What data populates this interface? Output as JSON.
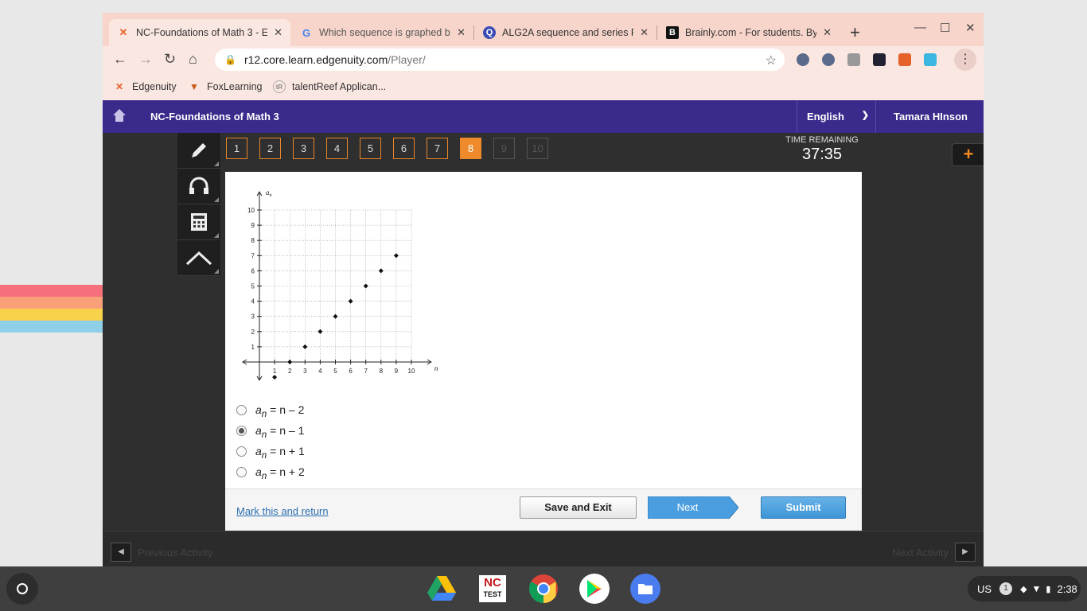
{
  "browser": {
    "tabs": [
      {
        "title": "NC-Foundations of Math 3 - Ed",
        "active": true,
        "favicon": "edgenuity-x-icon"
      },
      {
        "title": "Which sequence is graphed be",
        "active": false,
        "favicon": "google-g-icon"
      },
      {
        "title": "ALG2A sequence and series Fl",
        "active": false,
        "favicon": "quizlet-q-icon"
      },
      {
        "title": "Brainly.com - For students. By",
        "active": false,
        "favicon": "brainly-b-icon"
      }
    ],
    "new_tab": "+",
    "url_host": "r12.core.learn.edgenuity.com",
    "url_path": "/Player/",
    "bookmarks": [
      {
        "label": "Edgenuity"
      },
      {
        "label": "FoxLearning"
      },
      {
        "label": "talentReef Applican..."
      }
    ]
  },
  "app": {
    "course_title": "NC-Foundations of Math 3",
    "language": "English",
    "user_name": "Tamara HInson",
    "timer_label": "TIME REMAINING",
    "timer_value": "37:35",
    "question_numbers": [
      {
        "label": "1",
        "state": "done"
      },
      {
        "label": "2",
        "state": "done"
      },
      {
        "label": "3",
        "state": "done"
      },
      {
        "label": "4",
        "state": "done"
      },
      {
        "label": "5",
        "state": "done"
      },
      {
        "label": "6",
        "state": "done"
      },
      {
        "label": "7",
        "state": "done"
      },
      {
        "label": "8",
        "state": "current"
      },
      {
        "label": "9",
        "state": "disabled"
      },
      {
        "label": "10",
        "state": "disabled"
      }
    ],
    "tools": [
      "pencil-icon",
      "headphones-icon",
      "calculator-icon",
      "protractor-icon"
    ],
    "answers": [
      {
        "lhs": "a",
        "sub": "n",
        "rhs": " = n – 2",
        "selected": false
      },
      {
        "lhs": "a",
        "sub": "n",
        "rhs": " = n – 1",
        "selected": true
      },
      {
        "lhs": "a",
        "sub": "n",
        "rhs": " = n + 1",
        "selected": false
      },
      {
        "lhs": "a",
        "sub": "n",
        "rhs": " = n + 2",
        "selected": false
      }
    ],
    "mark_link": "Mark this and return",
    "save_label": "Save and Exit",
    "next_label": "Next",
    "submit_label": "Submit",
    "prev_activity": "Previous Activity",
    "next_activity": "Next Activity"
  },
  "chart_data": {
    "type": "scatter",
    "xlabel": "n",
    "ylabel": "an",
    "x_ticks": [
      "1",
      "2",
      "3",
      "4",
      "5",
      "6",
      "7",
      "8",
      "9",
      "10"
    ],
    "y_ticks": [
      "1",
      "2",
      "3",
      "4",
      "5",
      "6",
      "7",
      "8",
      "9",
      "10"
    ],
    "xlim": [
      -1,
      11
    ],
    "ylim": [
      -1,
      11
    ],
    "grid": true,
    "points": [
      {
        "x": 1,
        "y": -1
      },
      {
        "x": 2,
        "y": 0
      },
      {
        "x": 3,
        "y": 1
      },
      {
        "x": 4,
        "y": 2
      },
      {
        "x": 5,
        "y": 3
      },
      {
        "x": 6,
        "y": 4
      },
      {
        "x": 7,
        "y": 5
      },
      {
        "x": 8,
        "y": 6
      },
      {
        "x": 9,
        "y": 7
      }
    ]
  },
  "shelf": {
    "apps": [
      "google-drive-icon",
      "nc-test-icon",
      "chrome-icon",
      "play-store-icon",
      "files-icon"
    ],
    "nc_test_text": "NC",
    "nc_test_sub": "TEST",
    "locale": "US",
    "notification_count": "1",
    "time": "2:38"
  }
}
